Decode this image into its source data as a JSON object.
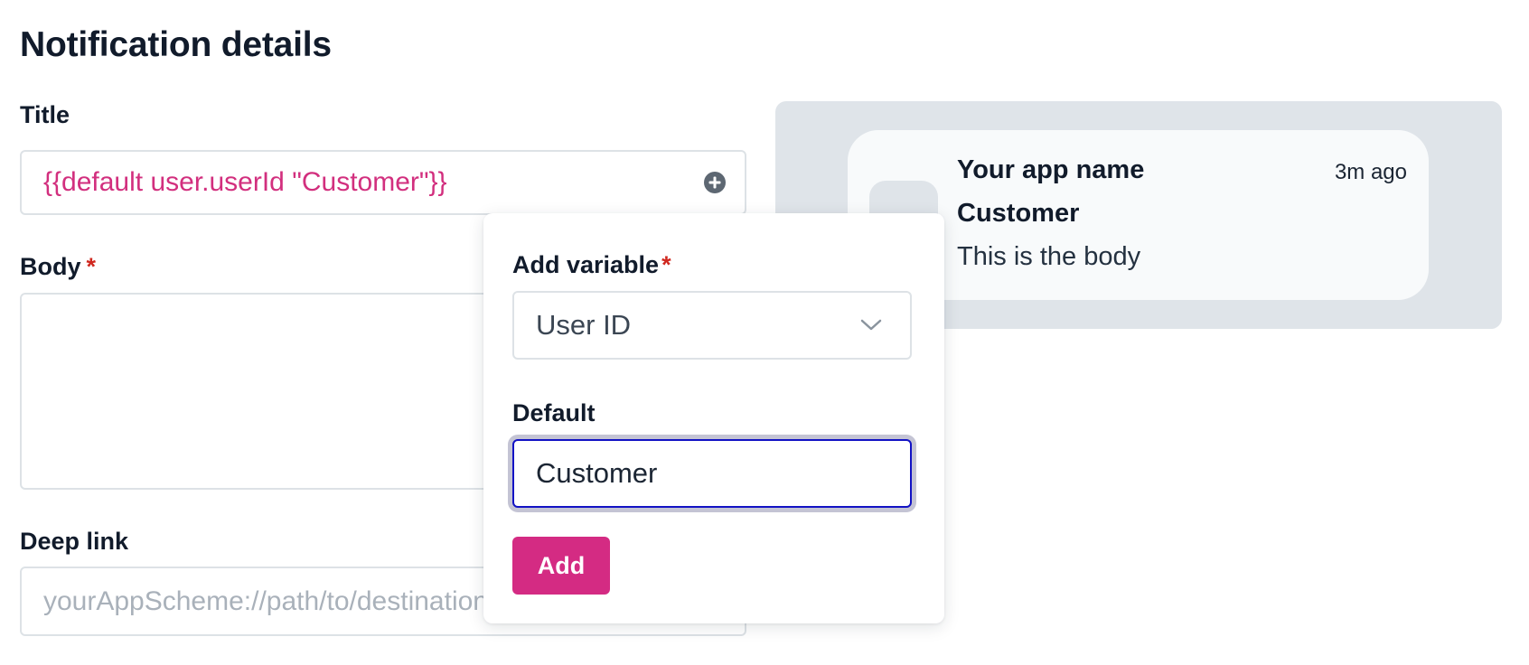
{
  "section": {
    "heading": "Notification details"
  },
  "form": {
    "title": {
      "label": "Title",
      "value": "{{default user.userId \"Customer\"}}"
    },
    "body": {
      "label": "Body",
      "required_mark": "*",
      "value": ""
    },
    "deep_link": {
      "label": "Deep link",
      "placeholder": "yourAppScheme://path/to/destination"
    }
  },
  "popover": {
    "variable_label": "Add variable",
    "required_mark": "*",
    "selected_variable": "User ID",
    "default_label": "Default",
    "default_value": "Customer",
    "add_label": "Add"
  },
  "preview": {
    "app_name": "Your app name",
    "time": "3m ago",
    "title": "Customer",
    "body": "This is the body"
  },
  "colors": {
    "accent": "#d42b83",
    "variable_text": "#d22f7e",
    "required": "#d0281f",
    "focus": "#1212c4",
    "preview_bg": "#dfe4e9"
  },
  "icons": {
    "insert_variable": "plus-circle-icon",
    "select_arrow": "chevron-down-icon"
  }
}
